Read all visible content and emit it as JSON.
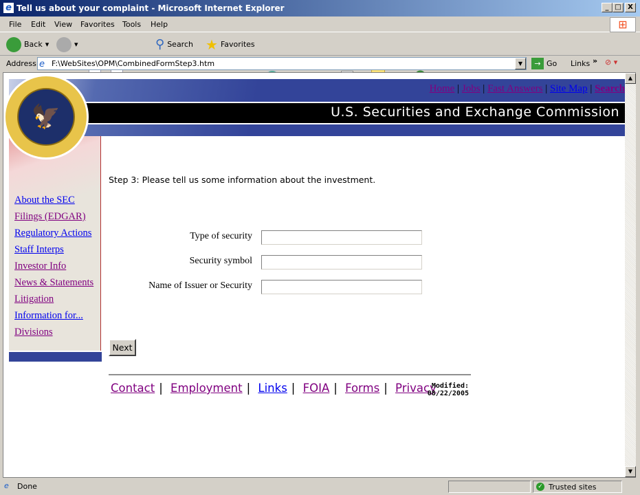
{
  "window": {
    "title": "Tell us about your complaint - Microsoft Internet Explorer",
    "min": "_",
    "max": "□",
    "close": "X"
  },
  "menu": [
    "File",
    "Edit",
    "View",
    "Favorites",
    "Tools",
    "Help"
  ],
  "toolbar": {
    "back": "Back",
    "search": "Search",
    "favorites": "Favorites"
  },
  "address": {
    "label": "Address",
    "value": "F:\\WebSites\\OPM\\CombinedFormStep3.htm",
    "go": "Go",
    "links": "Links"
  },
  "banner": {
    "title": "U.S. Securities and Exchange Commission",
    "seal_text": "SECURITIES AND EXCHANGE COMMISSION MCMXXXIV",
    "links": [
      {
        "label": "Home",
        "visited": true
      },
      {
        "label": "Jobs",
        "visited": true
      },
      {
        "label": "Fast Answers",
        "visited": true
      },
      {
        "label": "Site Map",
        "visited": false
      },
      {
        "label": "Search",
        "visited": true
      }
    ]
  },
  "sidebar": [
    {
      "label": "About the SEC",
      "visited": false
    },
    {
      "label": "Filings (EDGAR)",
      "visited": true
    },
    {
      "label": "Regulatory Actions",
      "visited": false
    },
    {
      "label": "Staff Interps",
      "visited": false
    },
    {
      "label": "Investor Info",
      "visited": true
    },
    {
      "label": "News & Statements",
      "visited": true
    },
    {
      "label": "Litigation",
      "visited": true
    },
    {
      "label": "Information for...",
      "visited": false
    },
    {
      "label": "Divisions",
      "visited": true
    }
  ],
  "form": {
    "intro": "Step 3: Please tell us some information about the investment.",
    "fields": [
      {
        "label": "Type of security",
        "value": ""
      },
      {
        "label": "Security symbol",
        "value": ""
      },
      {
        "label": "Name of Issuer or Security",
        "value": ""
      }
    ],
    "next": "Next"
  },
  "footer": {
    "links": [
      {
        "label": "Contact",
        "visited": true
      },
      {
        "label": "Employment",
        "visited": true
      },
      {
        "label": "Links",
        "visited": false
      },
      {
        "label": "FOIA",
        "visited": true
      },
      {
        "label": "Forms",
        "visited": true
      },
      {
        "label": "Privacy",
        "visited": true
      }
    ],
    "modified_label": "Modified:",
    "modified_date": "08/22/2005"
  },
  "status": {
    "text": "Done",
    "zone": "Trusted sites"
  },
  "colors": {
    "visited": "#800080",
    "link": "#0000ee",
    "banner_blue": "#334499"
  }
}
